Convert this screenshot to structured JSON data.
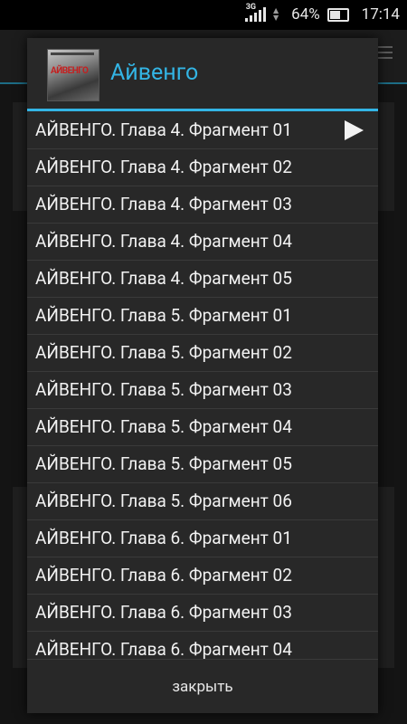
{
  "status_bar": {
    "network": "3G",
    "battery_percent": "64%",
    "time": "17:14",
    "icons": [
      "signal-icon",
      "battery-icon"
    ]
  },
  "dialog": {
    "cover_text": "АЙВЕНГО",
    "title": "Айвенго",
    "accent_color": "#33b5e5",
    "items": [
      {
        "label": "АЙВЕНГО. Глава 4. Фрагмент 01",
        "playing": true
      },
      {
        "label": "АЙВЕНГО. Глава 4. Фрагмент 02"
      },
      {
        "label": "АЙВЕНГО. Глава 4. Фрагмент 03"
      },
      {
        "label": "АЙВЕНГО. Глава 4. Фрагмент 04"
      },
      {
        "label": "АЙВЕНГО. Глава 4. Фрагмент 05"
      },
      {
        "label": "АЙВЕНГО. Глава 5. Фрагмент 01"
      },
      {
        "label": "АЙВЕНГО. Глава 5. Фрагмент 02"
      },
      {
        "label": "АЙВЕНГО. Глава 5. Фрагмент 03"
      },
      {
        "label": "АЙВЕНГО. Глава 5. Фрагмент 04"
      },
      {
        "label": "АЙВЕНГО. Глава 5. Фрагмент 05"
      },
      {
        "label": "АЙВЕНГО. Глава 5. Фрагмент 06"
      },
      {
        "label": "АЙВЕНГО. Глава 6. Фрагмент 01"
      },
      {
        "label": "АЙВЕНГО. Глава 6. Фрагмент 02"
      },
      {
        "label": "АЙВЕНГО. Глава 6. Фрагмент 03"
      },
      {
        "label": "АЙВЕНГО. Глава 6. Фрагмент 04"
      }
    ],
    "close_label": "закрыть"
  }
}
